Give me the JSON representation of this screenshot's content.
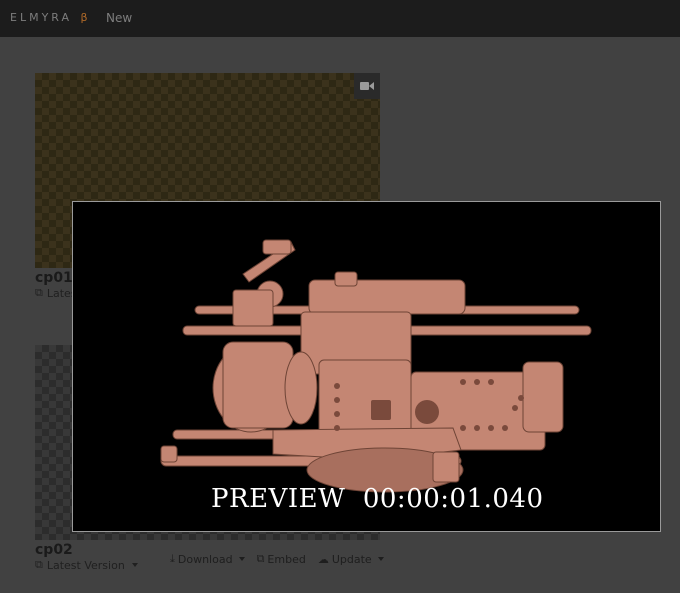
{
  "header": {
    "brand": "ELMYRA",
    "beta": "β",
    "new_label": "New"
  },
  "cards": [
    {
      "title": "cp01",
      "version_label": "Latest Version"
    },
    {
      "title": "cp02",
      "version_label": "Latest Version"
    }
  ],
  "card_actions": {
    "download": "Download",
    "embed": "Embed",
    "update": "Update"
  },
  "preview": {
    "label": "PREVIEW",
    "timecode": "00:00:01.040"
  },
  "colors": {
    "topbar": "#1c1c1c",
    "accent": "#b06a28",
    "render": "#c98b78"
  }
}
